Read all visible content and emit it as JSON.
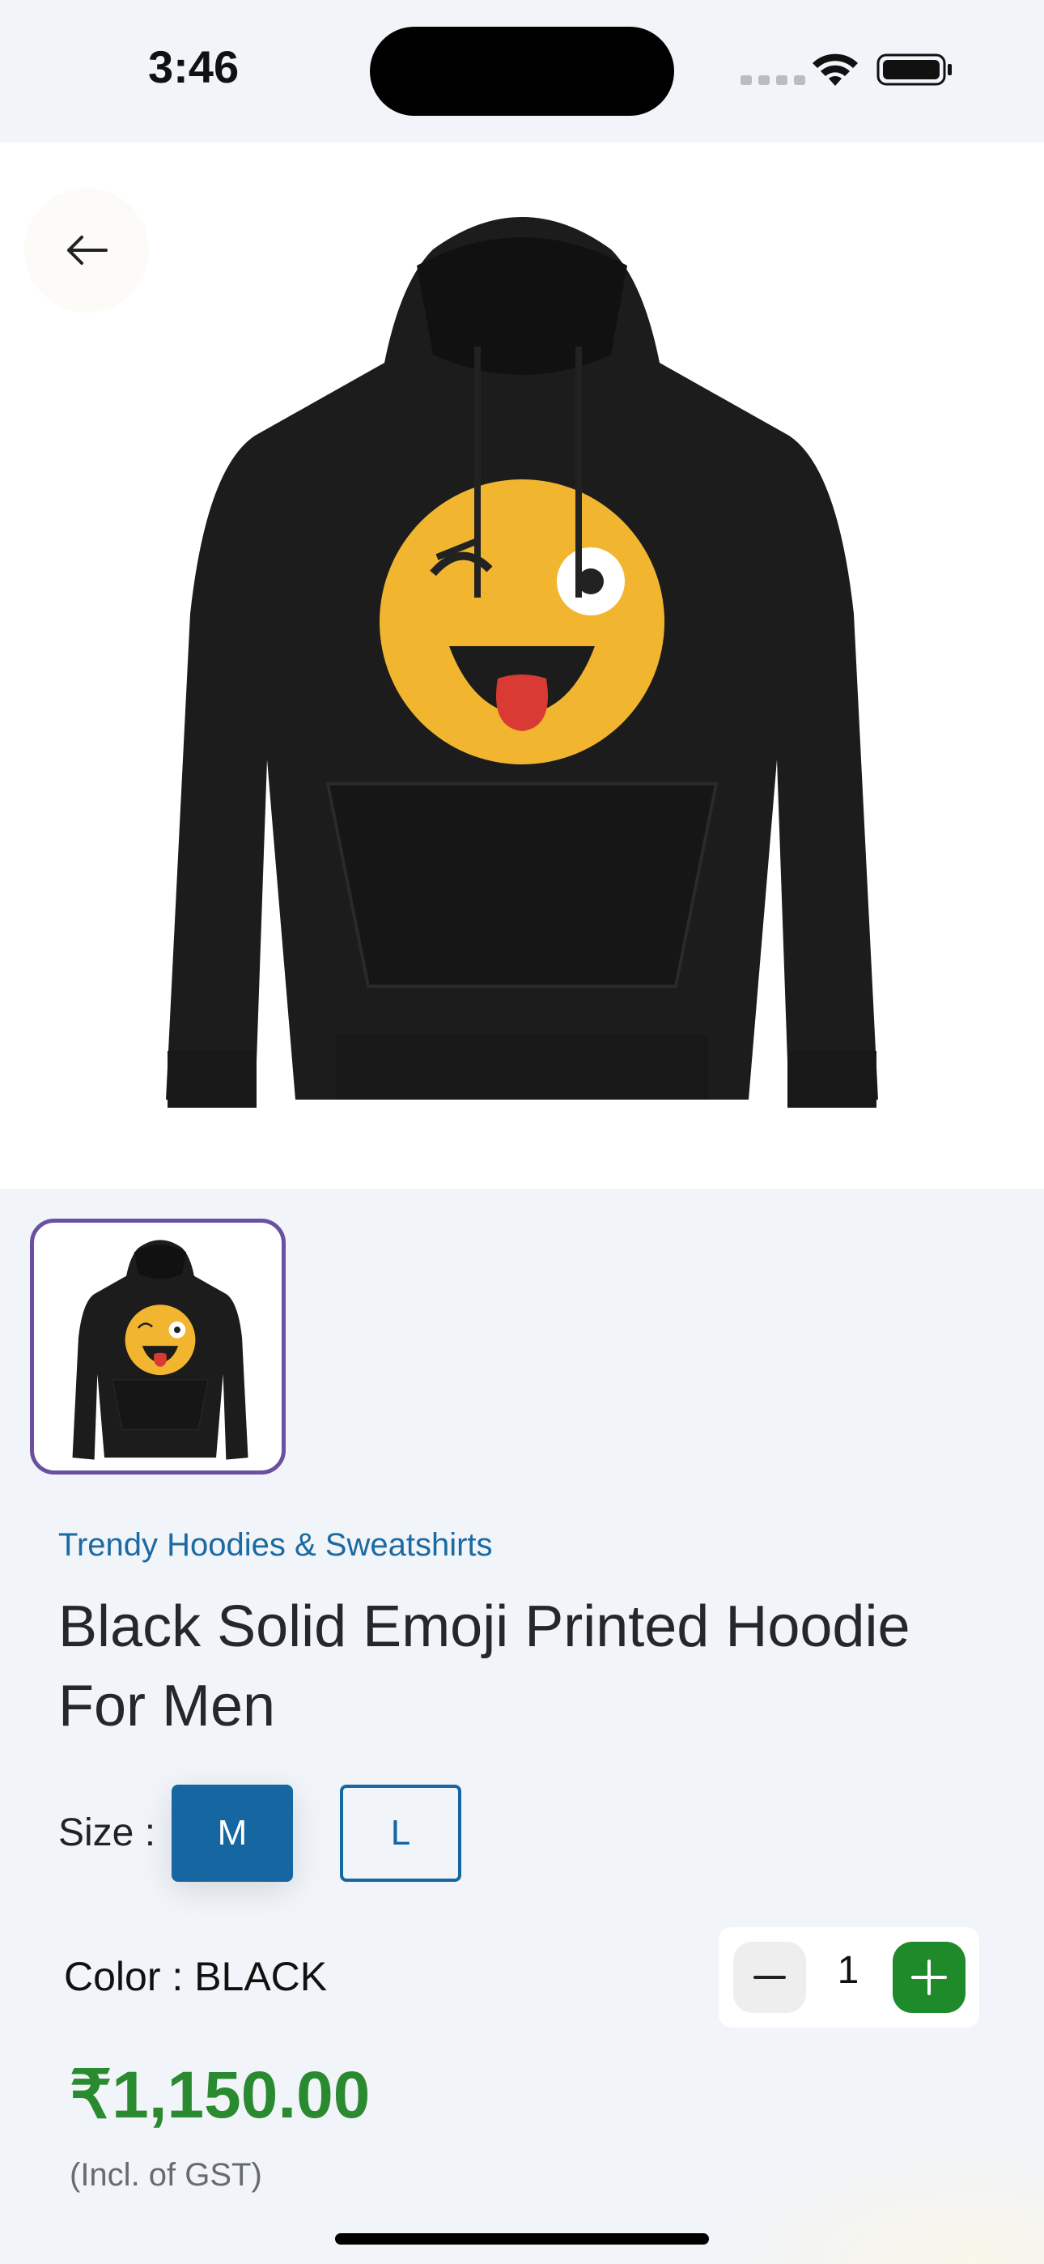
{
  "status_bar": {
    "time": "3:46"
  },
  "hero": {
    "image_alt": "Black hoodie with winking emoji print",
    "back_icon": "arrow-left-icon"
  },
  "thumbnails": [
    {
      "selected": true
    }
  ],
  "product": {
    "category": "Trendy Hoodies & Sweatshirts",
    "title": "Black Solid Emoji Printed Hoodie For Men",
    "size_label": "Size :",
    "sizes": [
      {
        "label": "M",
        "selected": true
      },
      {
        "label": "L",
        "selected": false
      }
    ],
    "color_label": "Color : BLACK",
    "quantity": "1",
    "price": "₹1,150.00",
    "tax_note": "(Incl. of GST)"
  },
  "colors": {
    "accent": "#1667a1",
    "price": "#2a8a2f",
    "plus_button": "#1f8a2a",
    "thumb_border": "#6b4fa0"
  }
}
